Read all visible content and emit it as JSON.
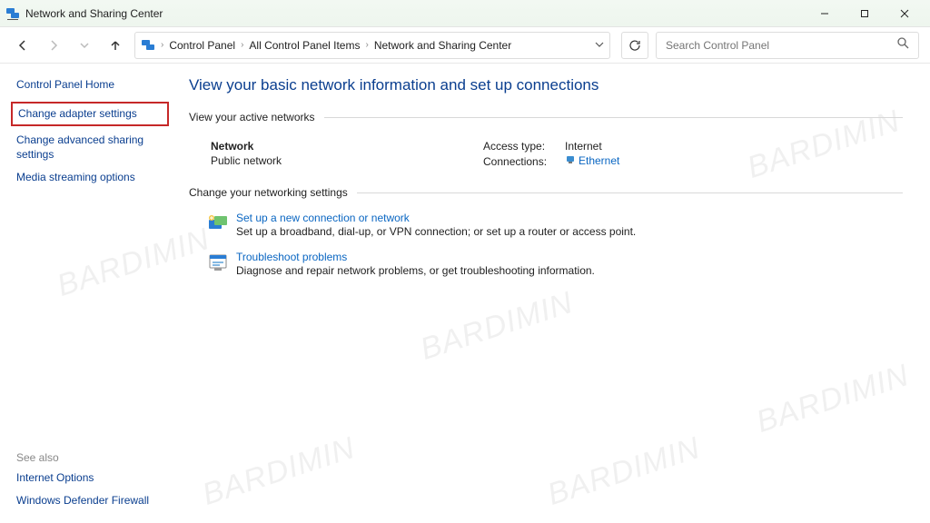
{
  "window": {
    "title": "Network and Sharing Center"
  },
  "breadcrumb": {
    "items": [
      "Control Panel",
      "All Control Panel Items",
      "Network and Sharing Center"
    ]
  },
  "search": {
    "placeholder": "Search Control Panel"
  },
  "sidebar": {
    "home": "Control Panel Home",
    "change_adapter": "Change adapter settings",
    "change_advanced": "Change advanced sharing settings",
    "media_streaming": "Media streaming options",
    "see_also_label": "See also",
    "internet_options": "Internet Options",
    "defender_firewall": "Windows Defender Firewall"
  },
  "main": {
    "page_title": "View your basic network information and set up connections",
    "active_section": "View your active networks",
    "network": {
      "name": "Network",
      "type": "Public network",
      "access_label": "Access type:",
      "access_value": "Internet",
      "conn_label": "Connections:",
      "conn_value": "Ethernet"
    },
    "change_section": "Change your networking settings",
    "opt1": {
      "title": "Set up a new connection or network",
      "desc": "Set up a broadband, dial-up, or VPN connection; or set up a router or access point."
    },
    "opt2": {
      "title": "Troubleshoot problems",
      "desc": "Diagnose and repair network problems, or get troubleshooting information."
    }
  },
  "watermark": "BARDIMIN"
}
